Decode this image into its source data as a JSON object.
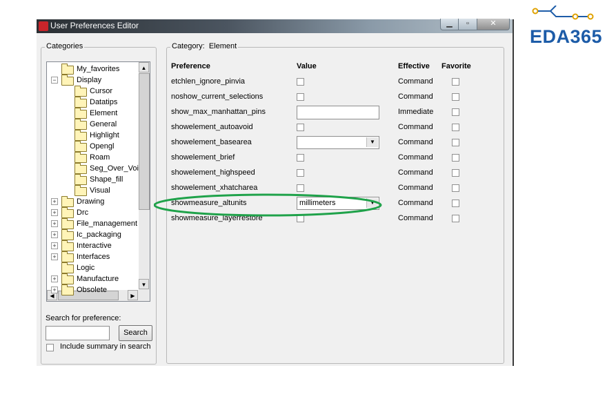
{
  "window": {
    "title": "User Preferences Editor"
  },
  "logo": {
    "text": "EDA365",
    "accent": "#e0a200",
    "brand": "#1d5ca8"
  },
  "categories": {
    "group_label": "Categories",
    "tree": [
      {
        "label": "My_favorites",
        "level": 0,
        "expander": ""
      },
      {
        "label": "Display",
        "level": 0,
        "expander": "-"
      },
      {
        "label": "Cursor",
        "level": 1
      },
      {
        "label": "Datatips",
        "level": 1
      },
      {
        "label": "Element",
        "level": 1
      },
      {
        "label": "General",
        "level": 1
      },
      {
        "label": "Highlight",
        "level": 1
      },
      {
        "label": "Opengl",
        "level": 1
      },
      {
        "label": "Roam",
        "level": 1
      },
      {
        "label": "Seg_Over_Voi",
        "level": 1
      },
      {
        "label": "Shape_fill",
        "level": 1
      },
      {
        "label": "Visual",
        "level": 1
      },
      {
        "label": "Drawing",
        "level": 0,
        "expander": "+"
      },
      {
        "label": "Drc",
        "level": 0,
        "expander": "+"
      },
      {
        "label": "File_management",
        "level": 0,
        "expander": "+"
      },
      {
        "label": "Ic_packaging",
        "level": 0,
        "expander": "+"
      },
      {
        "label": "Interactive",
        "level": 0,
        "expander": "+"
      },
      {
        "label": "Interfaces",
        "level": 0,
        "expander": "+"
      },
      {
        "label": "Logic",
        "level": 0,
        "expander": ""
      },
      {
        "label": "Manufacture",
        "level": 0,
        "expander": "+"
      },
      {
        "label": "Obsolete",
        "level": 0,
        "expander": "+"
      }
    ],
    "search_label": "Search for preference:",
    "search_value": "",
    "search_button": "Search",
    "include_summary_label": "Include summary in search"
  },
  "main": {
    "category_label": "Category:",
    "category_value": "Element",
    "headers": {
      "preference": "Preference",
      "value": "Value",
      "effective": "Effective",
      "favorite": "Favorite"
    },
    "rows": [
      {
        "name": "etchlen_ignore_pinvia",
        "control": "checkbox",
        "value": "",
        "effective": "Command"
      },
      {
        "name": "noshow_current_selections",
        "control": "checkbox",
        "value": "",
        "effective": "Command"
      },
      {
        "name": "show_max_manhattan_pins",
        "control": "text",
        "value": "",
        "effective": "Immediate"
      },
      {
        "name": "showelement_autoavoid",
        "control": "checkbox",
        "value": "",
        "effective": "Command"
      },
      {
        "name": "showelement_basearea",
        "control": "combo",
        "value": "",
        "effective": "Command"
      },
      {
        "name": "showelement_brief",
        "control": "checkbox",
        "value": "",
        "effective": "Command"
      },
      {
        "name": "showelement_highspeed",
        "control": "checkbox",
        "value": "",
        "effective": "Command"
      },
      {
        "name": "showelement_xhatcharea",
        "control": "checkbox",
        "value": "",
        "effective": "Command"
      },
      {
        "name": "showmeasure_altunits",
        "control": "combo",
        "value": "millimeters",
        "effective": "Command"
      },
      {
        "name": "showmeasure_layerrestore",
        "control": "checkbox",
        "value": "",
        "effective": "Command"
      }
    ],
    "highlight_color": "#1fa24a"
  }
}
